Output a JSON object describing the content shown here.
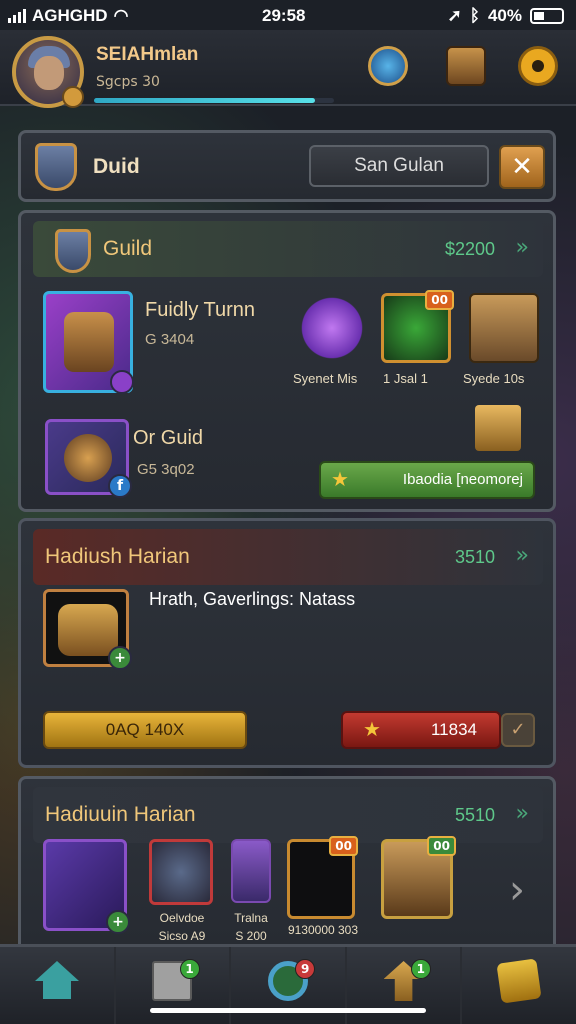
{
  "status": {
    "carrier": "AGHGHD",
    "time": "29:58",
    "battery": "40%"
  },
  "player": {
    "name": "SEIAHmlan",
    "sub": "Sgcps 30",
    "xp_percent": 92
  },
  "guildbar": {
    "title": "Duid",
    "search": "San Gulan",
    "close": "✕"
  },
  "card1": {
    "title": "Guild",
    "price": "$2200",
    "hero1_name": "Fuidly Turnn",
    "hero1_sub": "G 3404",
    "hero2_name": "Or Guid",
    "hero2_sub": "G5 3q02",
    "rewards": [
      {
        "label": "Syenet Mis",
        "count": ""
      },
      {
        "label": "1  Jsal  1",
        "count": "00"
      },
      {
        "label": "Syede 10s",
        "count": ""
      }
    ],
    "green_btn": "Ibaodia [neomorej"
  },
  "card2": {
    "title": "Hadiush Harian",
    "price": "3510",
    "desc": "Hrath, Gaverlings: Natass",
    "gold_btn": "0AQ 140X",
    "red_btn": "11834"
  },
  "card3": {
    "title": "Hadiuuin Harian",
    "price": "5510",
    "items": [
      {
        "label1": "",
        "label2": "",
        "badge": ""
      },
      {
        "label1": "Oelvdoe",
        "label2": "Sicso A9",
        "badge": ""
      },
      {
        "label1": "Tralna",
        "label2": "S 200",
        "badge": ""
      },
      {
        "label1": "9130000 303",
        "label2": "",
        "badge": "00"
      },
      {
        "label1": "",
        "label2": "",
        "badge": "00"
      }
    ]
  },
  "nav": [
    {
      "name": "home",
      "badge": ""
    },
    {
      "name": "notes",
      "badge": "1"
    },
    {
      "name": "ring",
      "badge": "9"
    },
    {
      "name": "upgrade",
      "badge": "1"
    },
    {
      "name": "edit",
      "badge": ""
    }
  ],
  "colors": {
    "accent_gold": "#e8b43a",
    "accent_green": "#5ec88a",
    "accent_red": "#c23a30"
  }
}
